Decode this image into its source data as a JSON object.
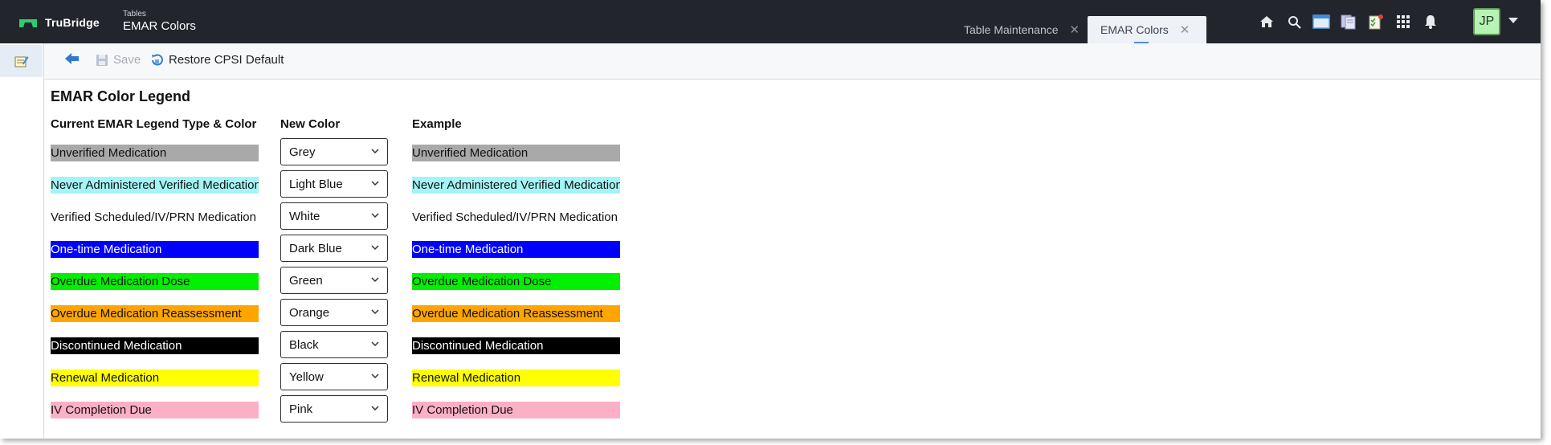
{
  "app": {
    "brand": "TruBridge",
    "breadcrumb_parent": "Tables",
    "breadcrumb_title": "EMAR Colors"
  },
  "tabs": [
    {
      "label": "Table Maintenance",
      "active": false
    },
    {
      "label": "EMAR Colors",
      "active": true
    }
  ],
  "header_icons": [
    "home-icon",
    "search-icon",
    "window-icon",
    "documents-icon",
    "checklist-icon",
    "apps-grid-icon",
    "bell-icon"
  ],
  "user": {
    "initials": "JP"
  },
  "toolbar": {
    "save_label": "Save",
    "restore_label": "Restore CPSI Default"
  },
  "legend": {
    "title": "EMAR Color Legend",
    "col_current": "Current EMAR Legend Type & Color",
    "col_new": "New Color",
    "col_example": "Example",
    "rows": [
      {
        "label": "Unverified Medication",
        "color": "Grey",
        "bg": "#a9a9a9",
        "fg": "#111111"
      },
      {
        "label": "Never Administered Verified Medication",
        "color": "Light Blue",
        "bg": "#a4f4f6",
        "fg": "#111111"
      },
      {
        "label": "Verified Scheduled/IV/PRN Medication",
        "color": "White",
        "bg": "#ffffff",
        "fg": "#111111"
      },
      {
        "label": "One-time Medication",
        "color": "Dark Blue",
        "bg": "#0000ff",
        "fg": "#ffffff"
      },
      {
        "label": "Overdue Medication Dose",
        "color": "Green",
        "bg": "#00f000",
        "fg": "#111111"
      },
      {
        "label": "Overdue Medication Reassessment",
        "color": "Orange",
        "bg": "#ffa500",
        "fg": "#111111"
      },
      {
        "label": "Discontinued Medication",
        "color": "Black",
        "bg": "#000000",
        "fg": "#ffffff"
      },
      {
        "label": "Renewal Medication",
        "color": "Yellow",
        "bg": "#ffff00",
        "fg": "#111111"
      },
      {
        "label": "IV Completion Due",
        "color": "Pink",
        "bg": "#fbb0c6",
        "fg": "#111111"
      }
    ]
  },
  "colors": {
    "topbar": "#22252b",
    "active_tab": "#eef2f6",
    "accent": "#4a90d9"
  }
}
